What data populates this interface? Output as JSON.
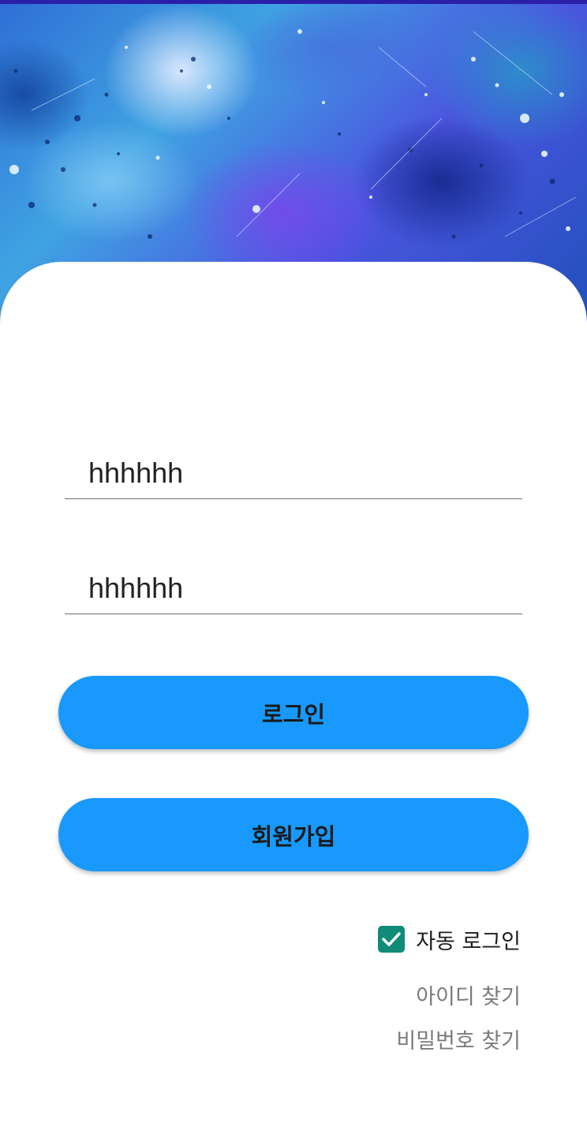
{
  "login_form": {
    "id_value": "hhhhhh",
    "password_value": "hhhhhh",
    "login_label": "로그인",
    "signup_label": "회원가입",
    "auto_login_label": "자동 로그인",
    "auto_login_checked": true,
    "find_id_label": "아이디 찾기",
    "find_password_label": "비밀번호 찾기"
  },
  "colors": {
    "accent": "#1899fb",
    "checkbox": "#0f8b78",
    "status_strip": "#2a1fa8"
  },
  "icons": {
    "checkbox": "check-icon",
    "hero": "watercolor-background"
  }
}
